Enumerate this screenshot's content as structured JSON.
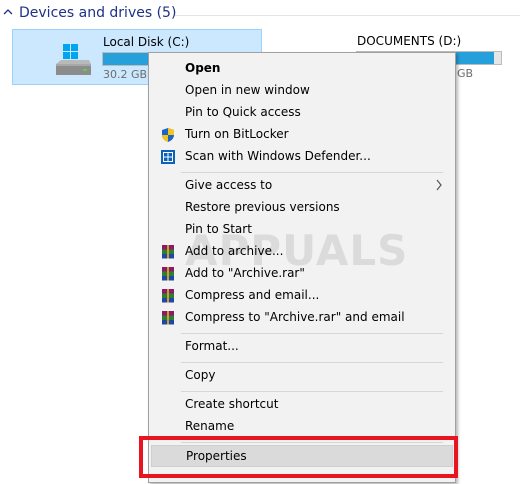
{
  "group": {
    "title": "Devices and drives (5)"
  },
  "drives": {
    "c": {
      "name": "Local Disk (C:)",
      "size_text": "30.2 GB f",
      "used_fraction": 0.78
    },
    "d": {
      "name": "DOCUMENTS (D:)",
      "size_text": "GB",
      "used_fraction": 0.95
    }
  },
  "watermark": "APPUALS",
  "menu": {
    "open": "Open",
    "open_new_window": "Open in new window",
    "pin_quick_access": "Pin to Quick access",
    "bitlocker": "Turn on BitLocker",
    "defender": "Scan with Windows Defender...",
    "give_access": "Give access to",
    "restore_versions": "Restore previous versions",
    "pin_start": "Pin to Start",
    "add_archive": "Add to archive...",
    "add_archive_rar": "Add to \"Archive.rar\"",
    "compress_email": "Compress and email...",
    "compress_rar_email": "Compress to \"Archive.rar\" and email",
    "format": "Format...",
    "copy": "Copy",
    "create_shortcut": "Create shortcut",
    "rename": "Rename",
    "properties": "Properties"
  },
  "colors": {
    "accent": "#26a0da",
    "selection": "#cce8ff",
    "annotation": "#e8141f"
  }
}
